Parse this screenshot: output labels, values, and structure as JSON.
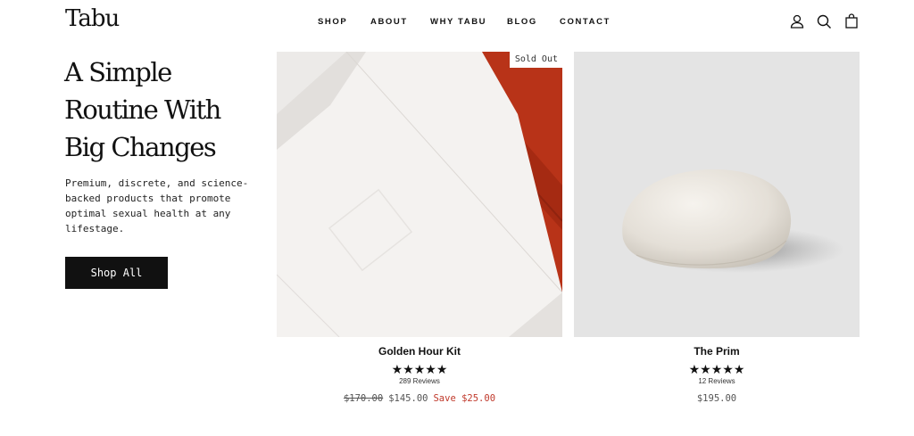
{
  "brand": {
    "logo": "Tabu"
  },
  "nav": {
    "items": [
      "SHOP",
      "ABOUT",
      "WHY TABU",
      "BLOG",
      "CONTACT"
    ]
  },
  "header_icons": [
    "account-icon",
    "search-icon",
    "cart-icon"
  ],
  "hero": {
    "title_lines": [
      "A Simple",
      "Routine With",
      "Big Changes"
    ],
    "description": "Premium, discrete, and science-backed products that promote optimal sexual health at any lifestage.",
    "cta_label": "Shop All"
  },
  "products": [
    {
      "name": "Golden Hour Kit",
      "badge": "Sold Out",
      "stars": "★★★★★",
      "reviews": "289 Reviews",
      "compare_price": "$170.00",
      "price": "$145.00",
      "save": "Save $25.00"
    },
    {
      "name": "The Prim",
      "stars": "★★★★★",
      "reviews": "12 Reviews",
      "price": "$195.00"
    }
  ],
  "colors": {
    "accent_sale": "#c0392b",
    "button_bg": "#111111",
    "text": "#111111"
  }
}
